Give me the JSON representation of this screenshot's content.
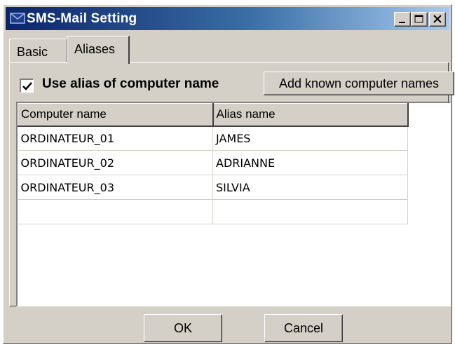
{
  "window": {
    "title": "SMS-Mail Setting"
  },
  "tabs": [
    {
      "label": "Basic",
      "active": false
    },
    {
      "label": "Aliases",
      "active": true
    }
  ],
  "aliases": {
    "use_alias_label": "Use alias of computer name",
    "use_alias_checked": true,
    "add_known_button": "Add known computer names",
    "columns": [
      "Computer name",
      "Alias name"
    ],
    "rows": [
      [
        "ORDINATEUR_01",
        "JAMES"
      ],
      [
        "ORDINATEUR_02",
        "ADRIANNE"
      ],
      [
        "ORDINATEUR_03",
        "SILVIA"
      ],
      [
        "",
        ""
      ]
    ]
  },
  "footer": {
    "ok_label": "OK",
    "cancel_label": "Cancel"
  },
  "colors": {
    "title_start": "#0a246a",
    "title_end": "#a6caf0",
    "face": "#d4d0c8"
  },
  "icons": [
    "mail-icon",
    "minimize-icon",
    "maximize-icon",
    "close-icon",
    "checkmark-icon"
  ]
}
